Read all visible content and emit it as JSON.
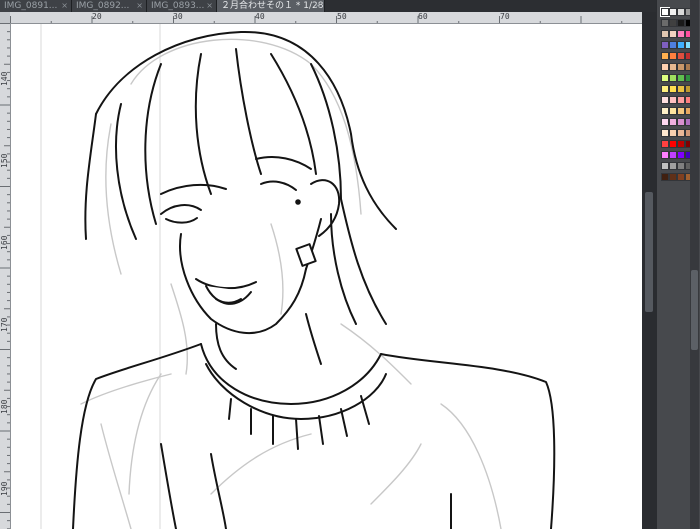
{
  "tabs": [
    {
      "label": "IMG_0891...",
      "active": false
    },
    {
      "label": "IMG_0892...",
      "active": false
    },
    {
      "label": "IMG_0893...",
      "active": false
    },
    {
      "label": "２月合わせその１ * 1/28",
      "active": true
    }
  ],
  "tab_close_glyph": "×",
  "ruler_top_labels": [
    "20",
    "30",
    "40",
    "50",
    "60",
    "70"
  ],
  "ruler_left_labels": [
    "140",
    "150",
    "160",
    "170",
    "180",
    "190"
  ],
  "colors": {
    "canvas_bg": "#ffffff",
    "ink": "#141414",
    "sketch": "#c8c8c8",
    "accent_tab": "#5a5e64"
  },
  "palette": {
    "selected_index": 0,
    "swatches": [
      "#ffffff",
      "#f0f0f0",
      "#d9d9d9",
      "#9a9a9a",
      "#6b6b6b",
      "#404040",
      "#1a1a1a",
      "#000000",
      "#e0c6b0",
      "#f2d2c0",
      "#ff7fbf",
      "#ff4fa0",
      "#7f5fbf",
      "#4f7fdf",
      "#3fafff",
      "#7fdfff",
      "#ffb04f",
      "#ff7f3f",
      "#df4f3f",
      "#bf2f2f",
      "#ffd0b0",
      "#e6b890",
      "#c9986a",
      "#a87a50",
      "#dfff7f",
      "#9fdf5f",
      "#5fbf4f",
      "#2f8f3f",
      "#ffef7f",
      "#ffdf4f",
      "#e8c040",
      "#c09a30",
      "#ffe0e0",
      "#ffc0c0",
      "#ff9f9f",
      "#ff7f7f",
      "#fff0c8",
      "#ffe4a0",
      "#f5c880",
      "#e8a860",
      "#ffd8f0",
      "#f0b0e0",
      "#d890d0",
      "#b070c0",
      "#ffe8d0",
      "#f8d0b0",
      "#eab898",
      "#d09878",
      "#ff4040",
      "#ff0000",
      "#c00000",
      "#800000",
      "#ff80ff",
      "#c040ff",
      "#8000ff",
      "#4000c0",
      "#c0c0c0",
      "#a0a0a0",
      "#808080",
      "#606060",
      "#402010",
      "#603018",
      "#804020",
      "#a06030"
    ]
  }
}
